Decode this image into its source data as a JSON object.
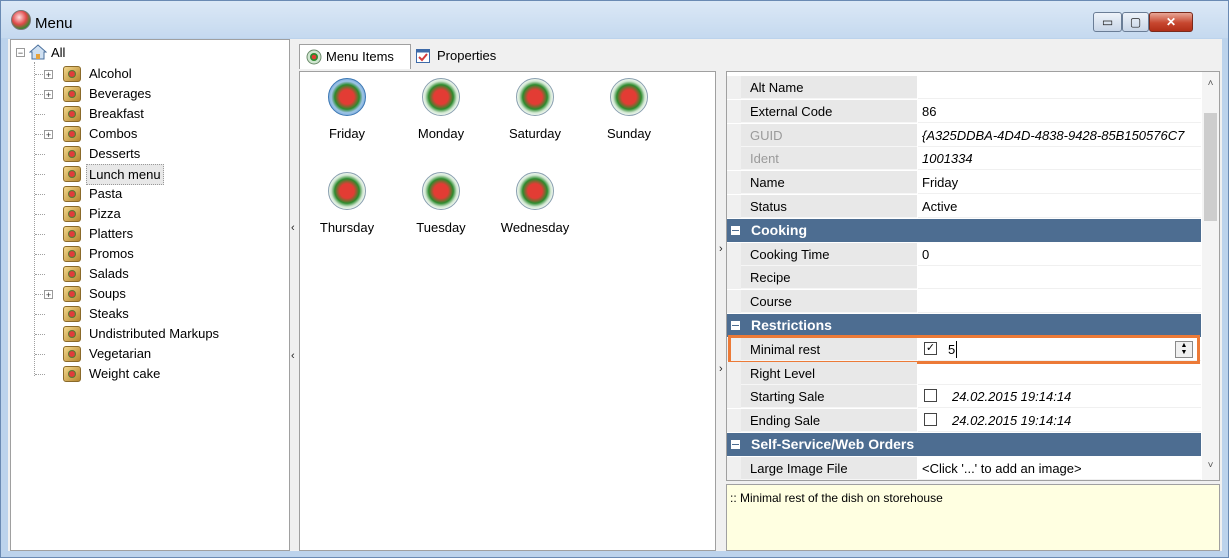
{
  "window": {
    "title": "Menu",
    "buttons": {
      "minimize": "▭",
      "maximize": "▢",
      "close": "✕"
    }
  },
  "tree": {
    "root": "All",
    "items": [
      {
        "label": "Alcohol",
        "expandable": true,
        "expander": "+"
      },
      {
        "label": "Beverages",
        "expandable": true,
        "expander": "+"
      },
      {
        "label": "Breakfast",
        "expandable": false
      },
      {
        "label": "Combos",
        "expandable": true,
        "expander": "+"
      },
      {
        "label": "Desserts",
        "expandable": false
      },
      {
        "label": "Lunch menu",
        "expandable": false,
        "selected": true
      },
      {
        "label": "Pasta",
        "expandable": false
      },
      {
        "label": "Pizza",
        "expandable": false
      },
      {
        "label": "Platters",
        "expandable": false
      },
      {
        "label": "Promos",
        "expandable": false
      },
      {
        "label": "Salads",
        "expandable": false
      },
      {
        "label": "Soups",
        "expandable": true,
        "expander": "+"
      },
      {
        "label": "Steaks",
        "expandable": false
      },
      {
        "label": "Undistributed Markups",
        "expandable": false
      },
      {
        "label": "Vegetarian",
        "expandable": false
      },
      {
        "label": "Weight cake",
        "expandable": false
      }
    ],
    "root_expander": "−"
  },
  "splitters": {
    "left_arrow": "‹",
    "right_arrow": "›"
  },
  "tabs": [
    {
      "label": "Menu Items",
      "active": true
    },
    {
      "label": "Properties",
      "active": false
    }
  ],
  "menu_items": [
    {
      "label": "Friday",
      "selected": true
    },
    {
      "label": "Monday"
    },
    {
      "label": "Saturday"
    },
    {
      "label": "Sunday"
    },
    {
      "label": "Thursday"
    },
    {
      "label": "Tuesday"
    },
    {
      "label": "Wednesday"
    }
  ],
  "properties": {
    "rows": [
      {
        "kind": "prop",
        "name": "Alt Name",
        "value": ""
      },
      {
        "kind": "prop",
        "name": "External Code",
        "value": "86"
      },
      {
        "kind": "prop",
        "name": "GUID",
        "value": "{A325DDBA-4D4D-4838-9428-85B150576C7",
        "disabled": true,
        "italic": true
      },
      {
        "kind": "prop",
        "name": "Ident",
        "value": "1001334",
        "disabled": true,
        "italic": true
      },
      {
        "kind": "prop",
        "name": "Name",
        "value": "Friday"
      },
      {
        "kind": "prop",
        "name": "Status",
        "value": "Active"
      },
      {
        "kind": "cat",
        "name": "Cooking"
      },
      {
        "kind": "prop",
        "name": "Cooking Time",
        "value": "0"
      },
      {
        "kind": "prop",
        "name": "Recipe",
        "value": ""
      },
      {
        "kind": "prop",
        "name": "Course",
        "value": ""
      },
      {
        "kind": "cat",
        "name": "Restrictions"
      },
      {
        "kind": "prop",
        "name": "Minimal rest",
        "value": "5",
        "checkbox": "checked",
        "editing": true
      },
      {
        "kind": "prop",
        "name": "Right Level",
        "value": ""
      },
      {
        "kind": "prop",
        "name": "Starting Sale",
        "value": "24.02.2015 19:14:14",
        "checkbox": "unchecked",
        "italic": true
      },
      {
        "kind": "prop",
        "name": "Ending Sale",
        "value": "24.02.2015 19:14:14",
        "checkbox": "unchecked",
        "italic": true
      },
      {
        "kind": "cat",
        "name": "Self-Service/Web Orders"
      },
      {
        "kind": "prop",
        "name": "Large Image File",
        "value": "<Click '...' to add an image>"
      }
    ],
    "check_mark": "✓",
    "spin_up": "▲",
    "spin_down": "▼",
    "scroll_up": "˄",
    "scroll_down": "˅"
  },
  "description": ":: Minimal rest of the dish on storehouse",
  "colors": {
    "category_header": "#4d6d91",
    "highlight": "#ec7a37",
    "description_bg": "#ffffe1"
  }
}
